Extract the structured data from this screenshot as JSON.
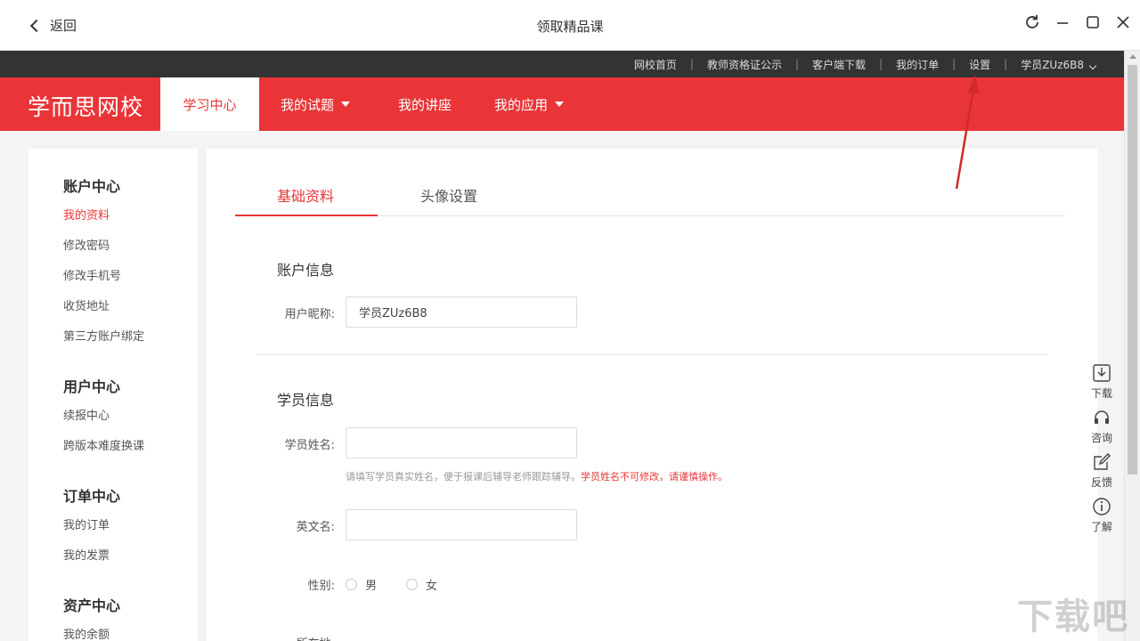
{
  "window": {
    "back_label": "返回",
    "title": "领取精品课"
  },
  "toplinks": [
    "网校首页",
    "教师资格证公示",
    "客户端下载",
    "我的订单",
    "设置",
    "学员ZUz6B8"
  ],
  "brand": {
    "logo": "学而思网校",
    "accent": "#e93537"
  },
  "nav": [
    {
      "label": "学习中心",
      "active": true
    },
    {
      "label": "我的试题",
      "dropdown": true
    },
    {
      "label": "我的讲座"
    },
    {
      "label": "我的应用",
      "dropdown": true
    }
  ],
  "sidebar": {
    "groups": [
      {
        "title": "账户中心",
        "items": [
          "我的资料",
          "修改密码",
          "修改手机号",
          "收货地址",
          "第三方账户绑定"
        ]
      },
      {
        "title": "用户中心",
        "items": [
          "续报中心",
          "跨版本难度换课"
        ]
      },
      {
        "title": "订单中心",
        "items": [
          "我的订单",
          "我的发票"
        ]
      },
      {
        "title": "资产中心",
        "items": [
          "我的余额"
        ]
      }
    ],
    "active_item": "我的资料"
  },
  "tabs": [
    {
      "label": "基础资料",
      "active": true
    },
    {
      "label": "头像设置"
    }
  ],
  "account": {
    "section_title": "账户信息",
    "nickname_label": "用户昵称:",
    "nickname_value": "学员ZUz6B8"
  },
  "student": {
    "section_title": "学员信息",
    "name_label": "学员姓名:",
    "name_value": "",
    "hint": "请填写学员真实姓名，便于报课后辅导老师跟踪辅导。",
    "hint_warn": "学员姓名不可修改，请谨慎操作。",
    "english_label": "英文名:",
    "english_value": "",
    "gender_label": "性别:",
    "gender_options": [
      "男",
      "女"
    ],
    "location_label": "所在地:"
  },
  "floattools": [
    {
      "icon": "download-icon",
      "label": "下载"
    },
    {
      "icon": "headset-icon",
      "label": "咨询"
    },
    {
      "icon": "feedback-icon",
      "label": "反馈"
    },
    {
      "icon": "info-icon",
      "label": "了解"
    }
  ],
  "watermark": "下载吧"
}
